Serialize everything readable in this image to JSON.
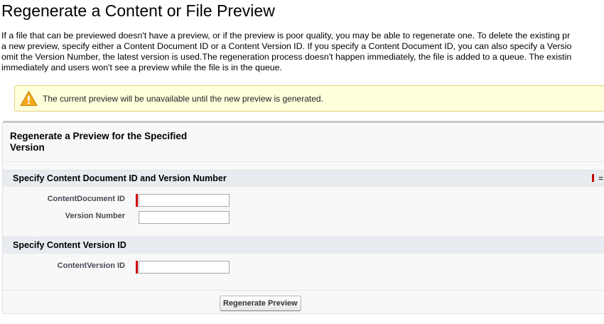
{
  "page": {
    "title": "Regenerate a Content or File Preview",
    "intro_lines": [
      "If a file that can be previewed doesn't have a preview, or if the preview is poor quality, you may be able to regenerate one. To delete the existing pr",
      "a new preview, specify either a Content Document ID or a Content Version ID. If you specify a Content Document ID, you can also specify a Versio",
      "omit the Version Number, the latest version is used.The regeneration process doesn't happen immediately, the file is added to a queue. The existin",
      "immediately and users won't see a preview while the file is in the queue."
    ]
  },
  "warning": {
    "icon": "warning-triangle-icon",
    "text": "The current preview will be unavailable until the new preview is generated.",
    "colors": {
      "background": "#ffffdc",
      "border": "#e3d07d",
      "icon": "#f2a818"
    }
  },
  "form": {
    "title": "Regenerate a Preview for the Specified Version",
    "required_legend": "=",
    "sections": [
      {
        "title": "Specify Content Document ID and Version Number",
        "fields": [
          {
            "label": "ContentDocument ID",
            "value": "",
            "required": true
          },
          {
            "label": "Version Number",
            "value": "",
            "required": false
          }
        ]
      },
      {
        "title": "Specify Content Version ID",
        "fields": [
          {
            "label": "ContentVersion ID",
            "value": "",
            "required": true
          }
        ]
      }
    ],
    "button_label": "Regenerate Preview"
  },
  "colors": {
    "required": "#cc0000",
    "section_header": "#e8ecf0",
    "block_background": "#f8f8f8"
  }
}
